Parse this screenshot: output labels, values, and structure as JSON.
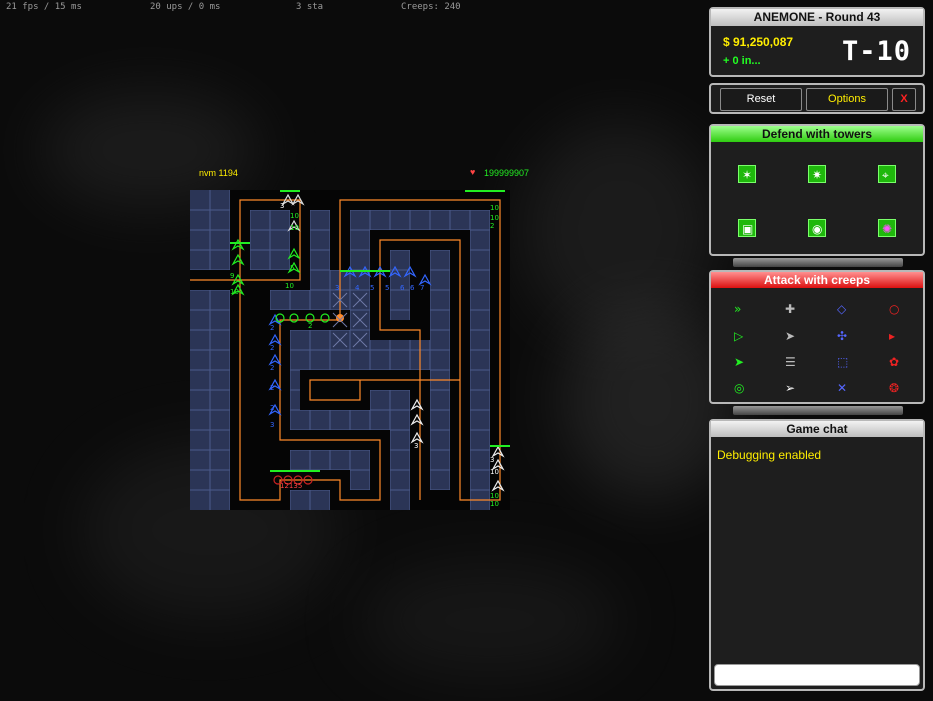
{
  "stats": {
    "fps": "21 fps / 15 ms",
    "ups": "20 ups / 0 ms",
    "sta": "3 sta",
    "creeps": "Creeps: 240"
  },
  "hud": {
    "player": "nvm 1194",
    "lives": "199999907"
  },
  "game": {
    "title": "ANEMONE - Round 43",
    "money": "$ 91,250,087",
    "income": "+ 0 in...",
    "timer": "T-10"
  },
  "buttons": {
    "reset": "Reset",
    "options": "Options",
    "close": "X"
  },
  "defend": {
    "title": "Defend with towers",
    "towers": [
      "laser-tower-icon",
      "spark-tower-icon",
      "swirl-tower-icon",
      "block-tower-icon",
      "orb-tower-icon",
      "pink-swirl-tower-icon"
    ]
  },
  "attack": {
    "title": "Attack with creeps"
  },
  "chat": {
    "title": "Game chat",
    "messages": [
      "Debugging enabled"
    ],
    "input_value": ""
  },
  "board_labels": [
    "3",
    "10",
    "10",
    "5",
    "9",
    "10",
    "10",
    "10",
    "10",
    "2",
    "3",
    "4",
    "5",
    "5",
    "6",
    "6",
    "7",
    "2",
    "2",
    "2",
    "2",
    "2",
    "2",
    "3",
    "3",
    "3",
    "10",
    "10",
    "10",
    "12135"
  ],
  "colors": {
    "path": "#ff8a2a",
    "grid": "#3c4a78",
    "green": "#22ee22",
    "yellow": "#ffee00",
    "red": "#ff2222",
    "blue": "#3366ff"
  }
}
